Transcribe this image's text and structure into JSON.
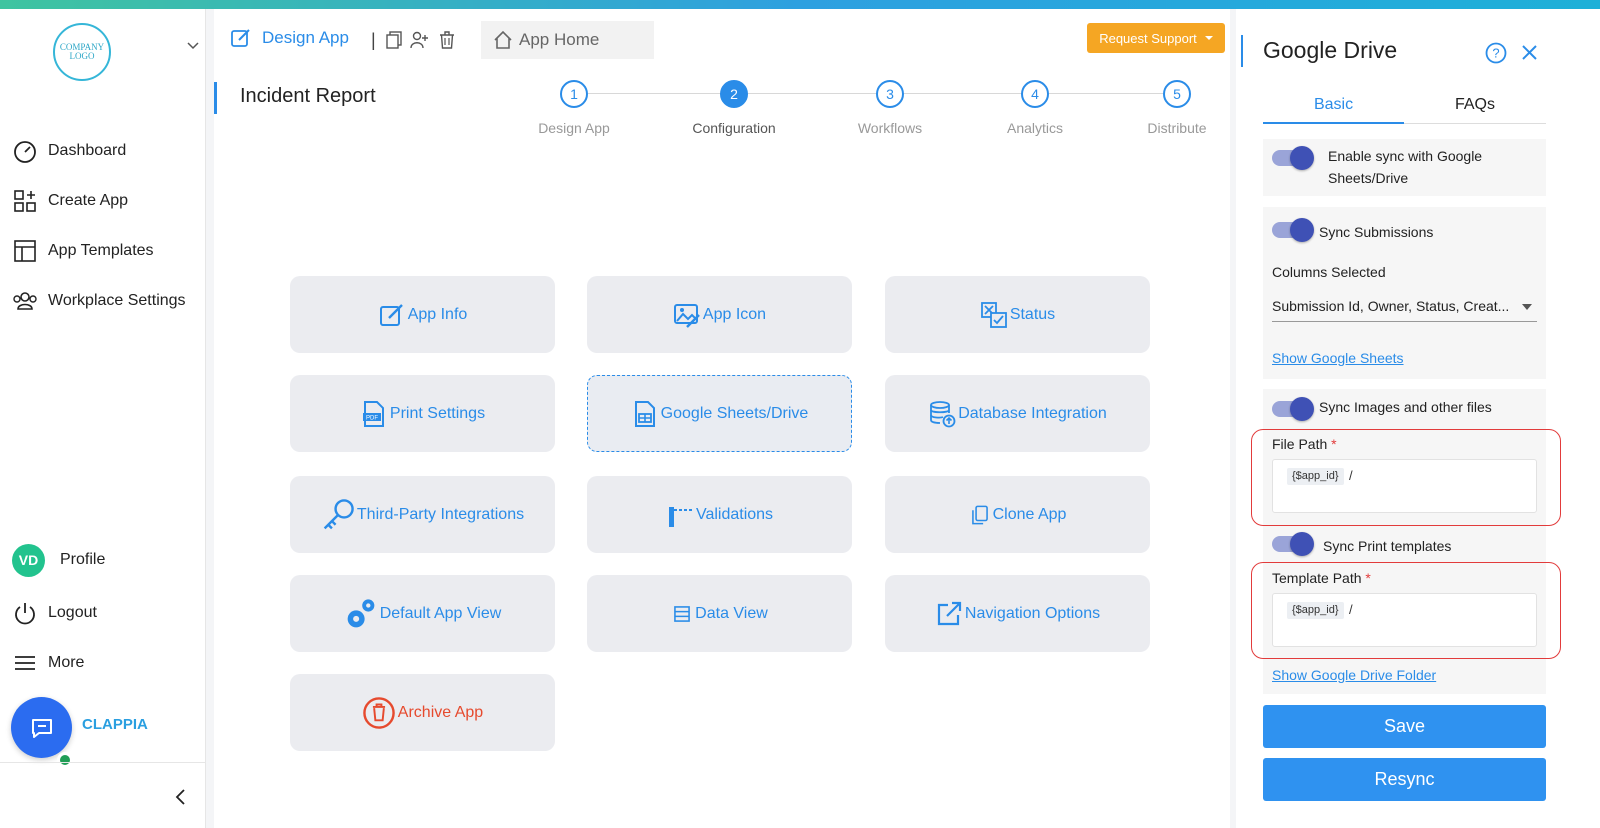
{
  "sidebar": {
    "logo_text_line1": "COMPANY",
    "logo_text_line2": "LOGO",
    "nav": [
      {
        "label": "Dashboard",
        "icon": "gauge-icon"
      },
      {
        "label": "Create App",
        "icon": "grid-plus-icon"
      },
      {
        "label": "App Templates",
        "icon": "template-icon"
      },
      {
        "label": "Workplace Settings",
        "icon": "people-icon"
      }
    ],
    "profile": {
      "initials": "VD",
      "label": "Profile"
    },
    "logout": "Logout",
    "more": "More",
    "brand": "CLAPPIA"
  },
  "header": {
    "design_tab": "Design App",
    "separator": "|",
    "home_tab": "App Home",
    "request_support": "Request Support"
  },
  "page": {
    "title": "Incident Report"
  },
  "stepper": [
    {
      "num": "1",
      "label": "Design App"
    },
    {
      "num": "2",
      "label": "Configuration",
      "active": true
    },
    {
      "num": "3",
      "label": "Workflows"
    },
    {
      "num": "4",
      "label": "Analytics"
    },
    {
      "num": "5",
      "label": "Distribute"
    }
  ],
  "cards": [
    {
      "label": "App Info"
    },
    {
      "label": "App Icon"
    },
    {
      "label": "Status"
    },
    {
      "label": "Print Settings"
    },
    {
      "label": "Google Sheets/Drive"
    },
    {
      "label": "Database Integration"
    },
    {
      "label": "Third-Party Integrations"
    },
    {
      "label": "Validations"
    },
    {
      "label": "Clone App"
    },
    {
      "label": "Default App View"
    },
    {
      "label": "Data View"
    },
    {
      "label": "Navigation Options"
    },
    {
      "label": "Archive App"
    }
  ],
  "panel": {
    "title": "Google Drive",
    "tabs": [
      "Basic",
      "FAQs"
    ],
    "enable_sync_line1": "Enable sync with Google",
    "enable_sync_line2": "Sheets/Drive",
    "sync_submissions": "Sync Submissions",
    "columns_selected": "Columns Selected",
    "columns_value": "Submission Id, Owner, Status, Creat...",
    "show_sheets": "Show Google Sheets",
    "sync_images": "Sync Images and other files",
    "file_path_label": "File Path",
    "required_mark": "*",
    "path_chip": "{$app_id}",
    "path_slash": "/",
    "sync_print": "Sync Print templates",
    "template_path_label": "Template Path",
    "show_drive": "Show Google Drive Folder",
    "save": "Save",
    "resync": "Resync"
  },
  "colors": {
    "accent": "#2a8ce8",
    "support": "#f5a623",
    "danger": "#e64a2e",
    "toggle": "#3f51b5"
  }
}
